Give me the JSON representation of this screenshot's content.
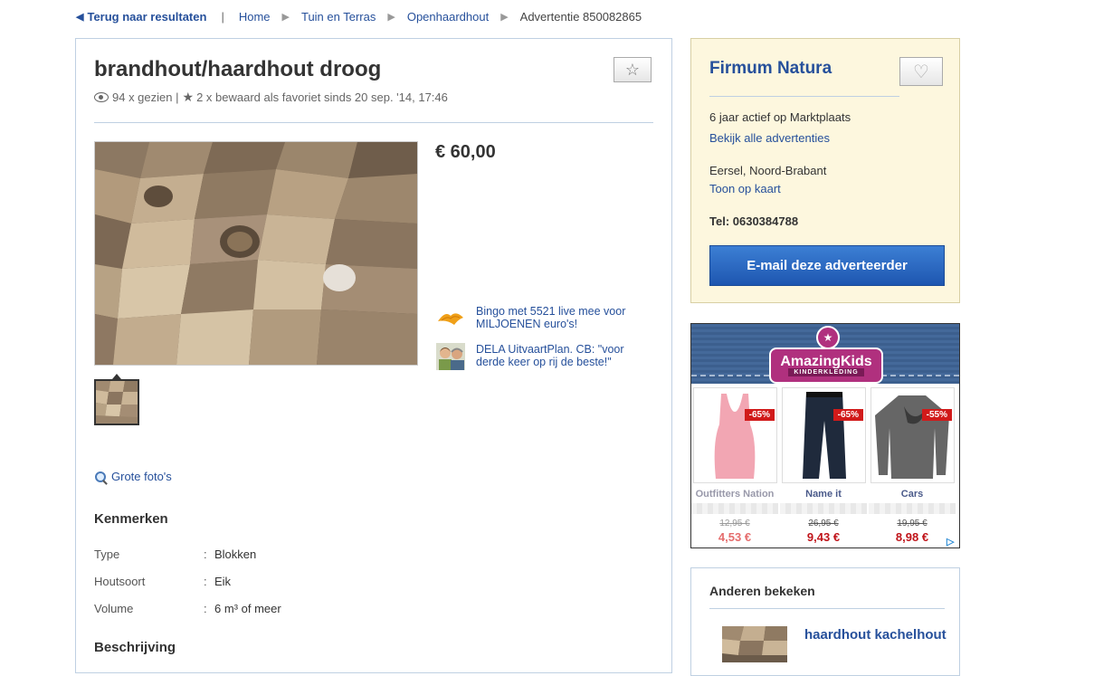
{
  "breadcrumb": {
    "back_label": "Terug naar resultaten",
    "items": [
      "Home",
      "Tuin en Terras",
      "Openhaardhout"
    ],
    "current": "Advertentie 850082865"
  },
  "listing": {
    "title": "brandhout/haardhout droog",
    "views": "94 x gezien",
    "favorites": "2 x bewaard als favoriet sinds 20 sep. '14, 17:46",
    "price": "€ 60,00",
    "big_photos_label": "Grote foto's"
  },
  "ads": [
    {
      "text": "Bingo met 5521 live mee voor MILJOENEN euro's!",
      "icon": "bingo-icon"
    },
    {
      "text": "DELA UitvaartPlan. CB: \"voor derde keer op rij de beste!\"",
      "icon": "dela-people-icon"
    }
  ],
  "kenmerken": {
    "title": "Kenmerken",
    "rows": [
      {
        "label": "Type",
        "value": "Blokken"
      },
      {
        "label": "Houtsoort",
        "value": "Eik"
      },
      {
        "label": "Volume",
        "value": "6 m³ of meer"
      }
    ]
  },
  "beschrijving_title": "Beschrijving",
  "seller": {
    "name": "Firmum Natura",
    "active": "6 jaar actief op Marktplaats",
    "all_ads_link": "Bekijk alle advertenties",
    "location": "Eersel, Noord-Brabant",
    "map_link": "Toon op kaart",
    "tel": "Tel: 0630384788",
    "email_button": "E-mail deze adverteerder"
  },
  "banner": {
    "brand_top": "AmazingKids",
    "brand_sub": "KINDERKLEDING",
    "products": [
      {
        "name": "Outfitters Nation",
        "discount": "-65%",
        "old_price": "12,95 €",
        "new_price": "4,53 €"
      },
      {
        "name": "Name it",
        "discount": "-65%",
        "old_price": "26,95 €",
        "new_price": "9,43 €"
      },
      {
        "name": "Cars",
        "discount": "-55%",
        "old_price": "19,95 €",
        "new_price": "8,98 €"
      }
    ]
  },
  "others": {
    "title": "Anderen bekeken",
    "item_title": "haardhout kachelhout"
  },
  "colors": {
    "link": "#26509b",
    "seller_bg": "#fdf7de",
    "button": "#2a66c2",
    "discount": "#d11a1a"
  }
}
